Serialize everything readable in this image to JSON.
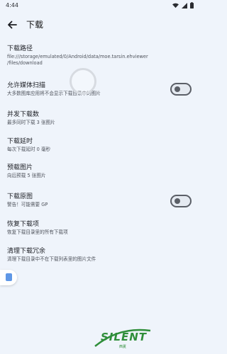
{
  "status_bar": {
    "time": "4:44"
  },
  "app_bar": {
    "title": "下载"
  },
  "preferences": [
    {
      "title": "下载路径",
      "summary": "file:///storage/emulated/0/Android/data/moe.tarsin.ehviewer\n/files/download"
    },
    {
      "title": "允许媒体扫描",
      "summary": "大多数图库应用将不会显示下载目录中的图片",
      "toggle": false
    },
    {
      "title": "并发下载数",
      "summary": "最多同时下载 3 张图片"
    },
    {
      "title": "下载延时",
      "summary": "每次下载延时 0 毫秒"
    },
    {
      "title": "预载图片",
      "summary": "向后预载 5 张图片"
    },
    {
      "title": "下载原图",
      "summary": "警告！可能需要 GP",
      "toggle": false
    },
    {
      "title": "恢复下载项",
      "summary": "恢复下载目录里的所有下载项"
    },
    {
      "title": "清理下载冗余",
      "summary": "清理下载目录中不在下载列表里的图片文件"
    }
  ],
  "watermark": {
    "text": "SILENT",
    "sub": "西夏"
  },
  "icons": {
    "back": "arrow-back-icon",
    "wifi": "wifi-icon",
    "signal": "signal-icon",
    "battery": "battery-icon",
    "loading": "loading-spinner",
    "floating": "floating-tab-icon"
  },
  "colors": {
    "background": "#eff4fb",
    "accent": "#5f97e6",
    "watermark": "#2f8e3a"
  }
}
